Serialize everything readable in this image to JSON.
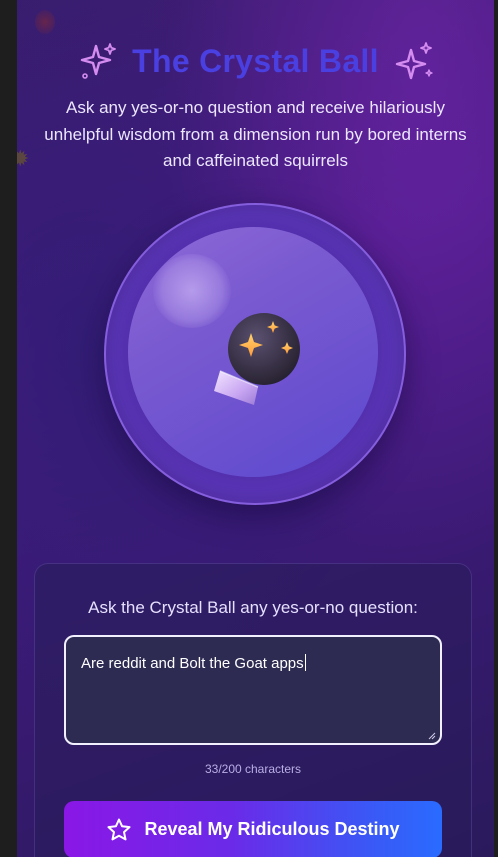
{
  "header": {
    "title": "The Crystal Ball",
    "subtitle": "Ask any yes-or-no question and receive hilariously unhelpful wisdom from a dimension run by bored interns and caffeinated squirrels",
    "left_icon": "sparkles-icon",
    "right_icon": "sparkles-icon"
  },
  "orb": {
    "emoji_icon": "crystal-ball-icon"
  },
  "form": {
    "prompt_label": "Ask the Crystal Ball any yes-or-no question:",
    "question_value": "Are reddit and Bolt the Goat apps",
    "char_count": "33/200 characters",
    "submit_label": "Reveal My Ridiculous Destiny",
    "submit_icon": "star-icon"
  },
  "colors": {
    "title": "#4a3fe0",
    "button_start": "#8a17e6",
    "button_end": "#2a6bff",
    "background": "#4b1a86"
  }
}
